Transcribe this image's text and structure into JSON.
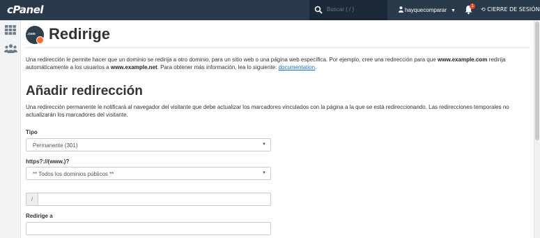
{
  "topbar": {
    "logo": "cPanel",
    "search_placeholder": "Buscar ( / )",
    "username": "hayquecomparar",
    "notification_count": "1",
    "logout_label": "CIERRE DE SESIÓN"
  },
  "sidebar": {
    "items": [
      {
        "icon": "grid-icon"
      },
      {
        "icon": "users-icon"
      }
    ]
  },
  "page": {
    "icon_text": ".com",
    "title": "Redirige",
    "intro_part1": "Una redirección le permite hacer que un dominio se redirija a otro dominio, para un sitio web o una página web específica. Por ejemplo, cree una redirección para que ",
    "intro_bold1": "www.example.com",
    "intro_part2": " redirija automáticamente a los usuarios a ",
    "intro_bold2": "www.example.net",
    "intro_part3": ". Para obtener más información, lea lo siguiente: ",
    "intro_link": "documentation",
    "intro_end": "."
  },
  "form": {
    "section_title": "Añadir redirección",
    "section_desc": "Una redirección permanente le notificará al navegador del visitante que debe actualizar los marcadores vinculados con la página a la que se está redireccionando. Las redirecciones temporales no actualizarán los marcadores del visitante.",
    "type_label": "Tipo",
    "type_value": "Permanente (301)",
    "domain_label": "https?://(www.)?",
    "domain_value": "** Todos los dominios públicos **",
    "path_prefix": "/",
    "path_value": "",
    "redirect_label": "Redirige a",
    "redirect_value": ""
  },
  "colors": {
    "topbar": "#293a4a",
    "accent": "#ff6c2c",
    "link": "#1c6fb6"
  }
}
